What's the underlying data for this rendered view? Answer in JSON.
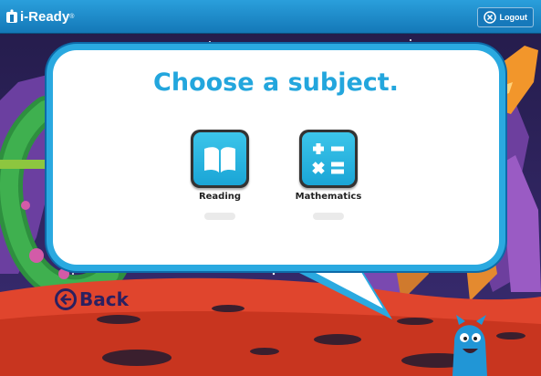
{
  "app": {
    "logo_text": "i-Ready",
    "logo_mark": "®"
  },
  "header": {
    "logout_label": "Logout"
  },
  "dialog": {
    "title": "Choose a subject.",
    "subjects": [
      {
        "label": "Reading",
        "icon": "book-icon"
      },
      {
        "label": "Mathematics",
        "icon": "math-operators-icon"
      }
    ]
  },
  "navigation": {
    "back_label": "Back"
  },
  "colors": {
    "accent": "#23a6dd",
    "topbar": "#1a86c6",
    "tile": "#29b5e3",
    "arrow": "#8dc63f",
    "ground": "#e0452d"
  }
}
